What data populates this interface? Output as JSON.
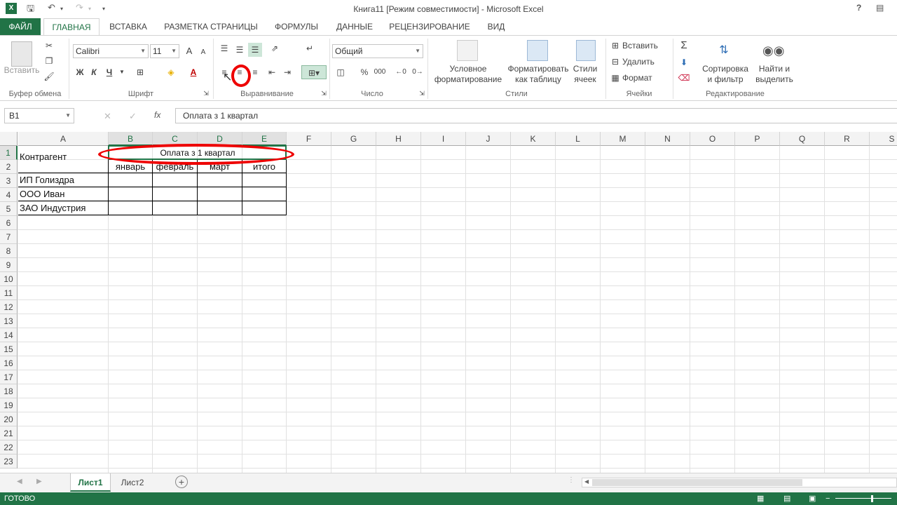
{
  "window": {
    "title": "Книга11  [Режим совместимости] - Microsoft Excel",
    "help": "?",
    "logo": "X"
  },
  "tabs": [
    "ФАЙЛ",
    "ГЛАВНАЯ",
    "ВСТАВКА",
    "РАЗМЕТКА СТРАНИЦЫ",
    "ФОРМУЛЫ",
    "ДАННЫЕ",
    "РЕЦЕНЗИРОВАНИЕ",
    "ВИД"
  ],
  "ribbon": {
    "clipboard": {
      "paste_label": "Вставить",
      "group_label": "Буфер обмена"
    },
    "font": {
      "name": "Calibri",
      "size": "11",
      "bold": "Ж",
      "italic": "К",
      "underline": "Ч",
      "grow": "A",
      "shrink": "A",
      "color_letter": "A",
      "group_label": "Шрифт"
    },
    "alignment": {
      "group_label": "Выравнивание"
    },
    "number": {
      "format": "Общий",
      "percent": "%",
      "thousands": "000",
      "group_label": "Число"
    },
    "styles": {
      "conditional": [
        "Условное",
        "форматирование"
      ],
      "as_table": [
        "Форматировать",
        "как таблицу"
      ],
      "cell_styles": [
        "Стили",
        "ячеек"
      ],
      "group_label": "Стили"
    },
    "cells": {
      "insert": "Вставить",
      "delete": "Удалить",
      "format": "Формат",
      "group_label": "Ячейки"
    },
    "editing": {
      "sort": [
        "Сортировка",
        "и фильтр"
      ],
      "find": [
        "Найти и",
        "выделить"
      ],
      "group_label": "Редактирование"
    }
  },
  "formula_bar": {
    "name_box": "B1",
    "fx": "fx",
    "content": "Оплата з 1 квартал"
  },
  "columns": [
    "A",
    "B",
    "C",
    "D",
    "E",
    "F",
    "G",
    "H",
    "I",
    "J",
    "K",
    "L",
    "M",
    "N",
    "O",
    "P",
    "Q",
    "R",
    "S"
  ],
  "rows": [
    "1",
    "2",
    "3",
    "4",
    "5",
    "6",
    "7",
    "8",
    "9",
    "10",
    "11",
    "12",
    "13",
    "14",
    "15",
    "16",
    "17",
    "18",
    "19",
    "20",
    "21",
    "22",
    "23"
  ],
  "cells": {
    "A1": "Контрагент",
    "B1": "Оплата з 1 квартал",
    "B2": "январь",
    "C2": "февраль",
    "D2": "март",
    "E2": "итого",
    "A3": "ИП Голиздра",
    "A4": "ООО Иван",
    "A5": "ЗАО Индустрия"
  },
  "sheets": [
    "Лист1",
    "Лист2"
  ],
  "status": {
    "text": "ГОТОВО"
  },
  "colors": {
    "accent": "#217346",
    "annotation": "#e00000"
  }
}
